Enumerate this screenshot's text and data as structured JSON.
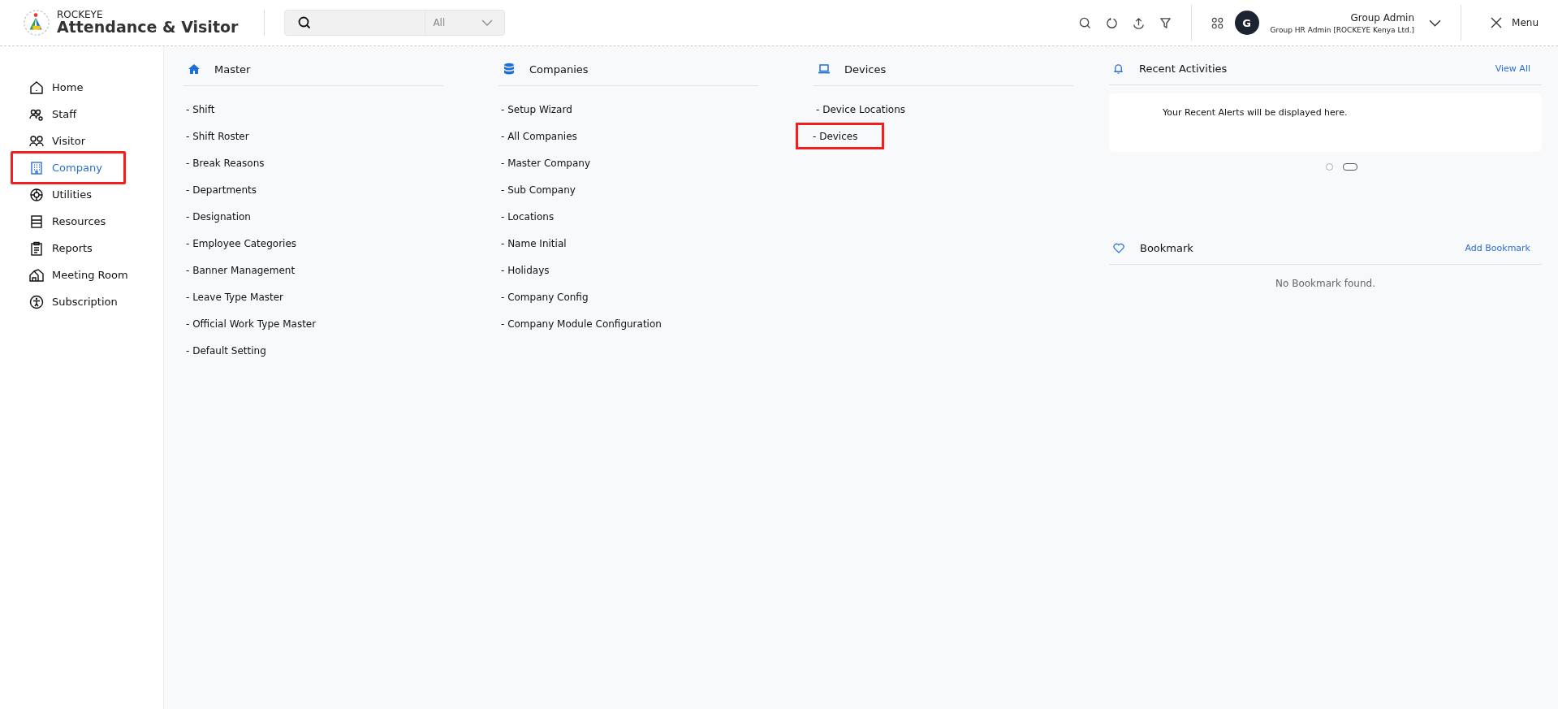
{
  "header": {
    "brand_top": "ROCKEYE",
    "brand_name": "Attendance & Visitor",
    "search": {
      "scope": "All"
    },
    "user": {
      "initial": "G",
      "name": "Group Admin",
      "role": "Group HR Admin [ROCKEYE Kenya Ltd.]"
    },
    "menu_label": "Menu"
  },
  "sidebar": {
    "items": [
      {
        "label": "Home",
        "selected": false,
        "highlighted": false
      },
      {
        "label": "Staff",
        "selected": false,
        "highlighted": false
      },
      {
        "label": "Visitor",
        "selected": false,
        "highlighted": false
      },
      {
        "label": "Company",
        "selected": true,
        "highlighted": true
      },
      {
        "label": "Utilities",
        "selected": false,
        "highlighted": false
      },
      {
        "label": "Resources",
        "selected": false,
        "highlighted": false
      },
      {
        "label": "Reports",
        "selected": false,
        "highlighted": false
      },
      {
        "label": "Meeting Room",
        "selected": false,
        "highlighted": false
      },
      {
        "label": "Subscription",
        "selected": false,
        "highlighted": false
      }
    ]
  },
  "sections": [
    {
      "title": "Master",
      "links": [
        {
          "label": "- Shift",
          "highlighted": false
        },
        {
          "label": "- Shift Roster",
          "highlighted": false
        },
        {
          "label": "- Break Reasons",
          "highlighted": false
        },
        {
          "label": "- Departments",
          "highlighted": false
        },
        {
          "label": "- Designation",
          "highlighted": false
        },
        {
          "label": "- Employee Categories",
          "highlighted": false
        },
        {
          "label": "- Banner Management",
          "highlighted": false
        },
        {
          "label": "- Leave Type Master",
          "highlighted": false
        },
        {
          "label": "- Official Work Type Master",
          "highlighted": false
        },
        {
          "label": "- Default Setting",
          "highlighted": false
        }
      ]
    },
    {
      "title": "Companies",
      "links": [
        {
          "label": "- Setup Wizard",
          "highlighted": false
        },
        {
          "label": "- All Companies",
          "highlighted": false
        },
        {
          "label": "- Master Company",
          "highlighted": false
        },
        {
          "label": "- Sub Company",
          "highlighted": false
        },
        {
          "label": "- Locations",
          "highlighted": false
        },
        {
          "label": "- Name Initial",
          "highlighted": false
        },
        {
          "label": "- Holidays",
          "highlighted": false
        },
        {
          "label": "- Company Config",
          "highlighted": false
        },
        {
          "label": "- Company Module Configuration",
          "highlighted": false
        }
      ]
    },
    {
      "title": "Devices",
      "links": [
        {
          "label": "- Device Locations",
          "highlighted": false
        },
        {
          "label": "- Devices",
          "highlighted": true
        }
      ]
    }
  ],
  "recent_activities": {
    "title": "Recent Activities",
    "action": "View All",
    "message": "Your Recent Alerts will be displayed here.",
    "carousel_dots": [
      {
        "selected": false
      },
      {
        "selected": true
      }
    ]
  },
  "bookmark": {
    "title": "Bookmark",
    "action": "Add Bookmark",
    "message": "No Bookmark found."
  }
}
